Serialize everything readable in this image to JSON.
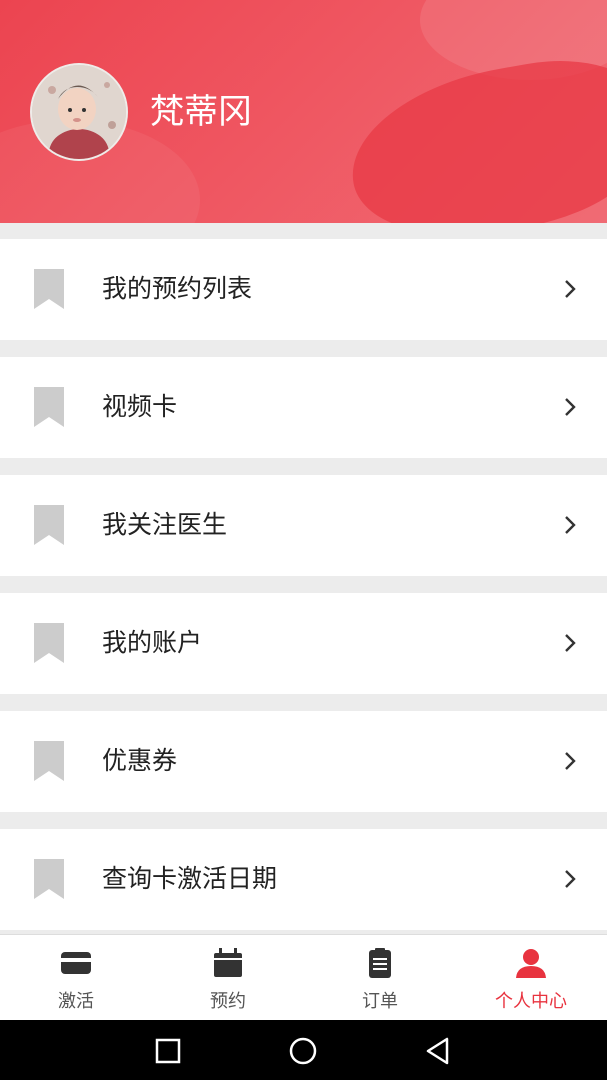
{
  "profile": {
    "username": "梵蒂冈",
    "avatar_icon": "avatar-photo"
  },
  "menu": {
    "items": [
      {
        "label": "我的预约列表",
        "icon": "bookmark-icon"
      },
      {
        "label": "视频卡",
        "icon": "bookmark-icon"
      },
      {
        "label": "我关注医生",
        "icon": "bookmark-icon"
      },
      {
        "label": "我的账户",
        "icon": "bookmark-icon"
      },
      {
        "label": "优惠券",
        "icon": "bookmark-icon"
      },
      {
        "label": "查询卡激活日期",
        "icon": "bookmark-icon"
      }
    ]
  },
  "tabbar": {
    "tabs": [
      {
        "label": "激活",
        "icon": "card-icon",
        "active": false
      },
      {
        "label": "预约",
        "icon": "calendar-icon",
        "active": false
      },
      {
        "label": "订单",
        "icon": "clipboard-icon",
        "active": false
      },
      {
        "label": "个人中心",
        "icon": "person-icon",
        "active": true
      }
    ]
  },
  "colors": {
    "accent": "#e8333f",
    "header": "#ec4450",
    "icon_gray": "#cccccc",
    "tab_icon": "#333333"
  }
}
